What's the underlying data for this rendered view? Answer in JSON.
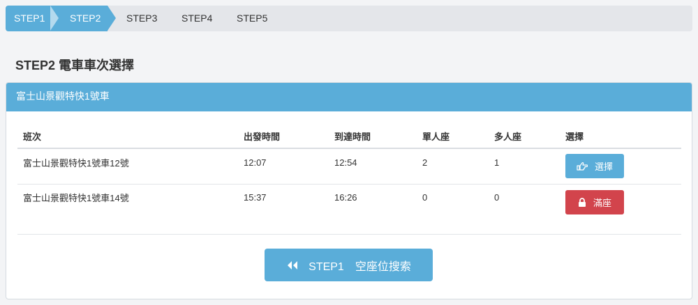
{
  "steps": [
    "STEP1",
    "STEP2",
    "STEP3",
    "STEP4",
    "STEP5"
  ],
  "active_step_index": 1,
  "page_title": "STEP2 電車車次選擇",
  "panel": {
    "title": "富士山景觀特快1號車",
    "columns": [
      "班次",
      "出發時間",
      "到達時間",
      "單人座",
      "多人座",
      "選擇"
    ],
    "rows": [
      {
        "train": "富士山景觀特快1號車12號",
        "depart": "12:07",
        "arrive": "12:54",
        "single": "2",
        "multi": "1",
        "action": "選擇",
        "action_type": "select"
      },
      {
        "train": "富士山景觀特快1號車14號",
        "depart": "15:37",
        "arrive": "16:26",
        "single": "0",
        "multi": "0",
        "action": "滿座",
        "action_type": "full"
      }
    ],
    "back_button": "STEP1　空座位搜索"
  },
  "icons": {
    "select": "hand-pointer-icon",
    "full": "lock-icon",
    "back": "double-chevron-left-icon"
  },
  "colors": {
    "primary": "#5aadd9",
    "danger": "#d2444c"
  }
}
